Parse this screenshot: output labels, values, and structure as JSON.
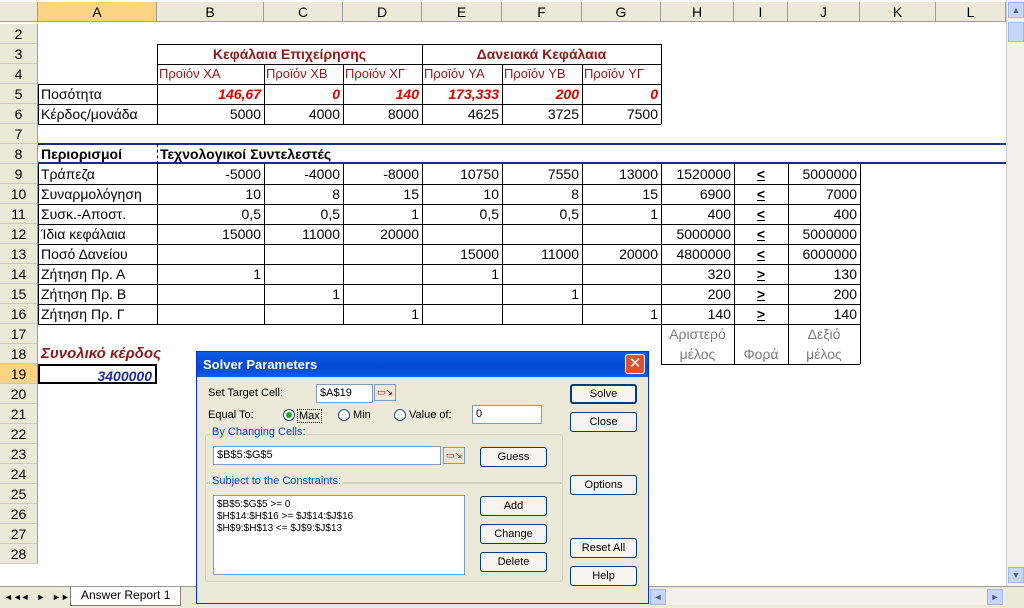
{
  "columns": [
    "A",
    "B",
    "C",
    "D",
    "E",
    "F",
    "G",
    "H",
    "I",
    "J",
    "K",
    "L"
  ],
  "selected_column": "A",
  "rows": [
    "2",
    "3",
    "4",
    "5",
    "6",
    "7",
    "8",
    "9",
    "10",
    "11",
    "12",
    "13",
    "14",
    "15",
    "16",
    "17",
    "18",
    "19",
    "20",
    "21",
    "22",
    "23",
    "24",
    "25",
    "26",
    "27",
    "28"
  ],
  "selected_row": "19",
  "sheet": {
    "header_capital": "Κεφάλαια Επιχείρησης",
    "header_loan": "Δανειακά Κεφάλαια",
    "products": [
      "Προϊόν XA",
      "Προϊόν XB",
      "Προϊόν XΓ",
      "Προϊόν YA",
      "Προϊόν YB",
      "Προϊόν YΓ"
    ],
    "row5_label": "Ποσότητα",
    "quantities": [
      "146,67",
      "0",
      "140",
      "173,333",
      "200",
      "0"
    ],
    "row6_label": "Κέρδος/μονάδα",
    "profits": [
      "5000",
      "4000",
      "8000",
      "4625",
      "3725",
      "7500"
    ],
    "constraints_title": "Περιορισμοί",
    "coeff_title": "Τεχνολογικοί  Συντελεστές",
    "constraint_rows": [
      {
        "label": "Τράπεζα",
        "b": "-5000",
        "c": "-4000",
        "d": "-8000",
        "e": "10750",
        "f": "7550",
        "g": "13000",
        "h": "1520000",
        "i": "<",
        "j": "5000000"
      },
      {
        "label": "Συναρμολόγηση",
        "b": "10",
        "c": "8",
        "d": "15",
        "e": "10",
        "f": "8",
        "g": "15",
        "h": "6900",
        "i": "<",
        "j": "7000"
      },
      {
        "label": "Συσκ.-Αποστ.",
        "b": "0,5",
        "c": "0,5",
        "d": "1",
        "e": "0,5",
        "f": "0,5",
        "g": "1",
        "h": "400",
        "i": "<",
        "j": "400"
      },
      {
        "label": "Ίδια κεφάλαια",
        "b": "15000",
        "c": "11000",
        "d": "20000",
        "e": "",
        "f": "",
        "g": "",
        "h": "5000000",
        "i": "<",
        "j": "5000000"
      },
      {
        "label": "Ποσό Δανείου",
        "b": "",
        "c": "",
        "d": "",
        "e": "15000",
        "f": "11000",
        "g": "20000",
        "h": "4800000",
        "i": "<",
        "j": "6000000"
      },
      {
        "label": "Ζήτηση Πρ.  Α",
        "b": "1",
        "c": "",
        "d": "",
        "e": "1",
        "f": "",
        "g": "",
        "h": "320",
        "i": ">",
        "j": "130"
      },
      {
        "label": "Ζήτηση Πρ.  Β",
        "b": "",
        "c": "1",
        "d": "",
        "e": "",
        "f": "1",
        "g": "",
        "h": "200",
        "i": ">",
        "j": "200"
      },
      {
        "label": "Ζήτηση Πρ.  Γ",
        "b": "",
        "c": "",
        "d": "1",
        "e": "",
        "f": "",
        "g": "1",
        "h": "140",
        "i": ">",
        "j": "140"
      }
    ],
    "lhs_label_1": "Αριστερό",
    "lhs_label_2": "μέλος",
    "direction_label": "Φορά",
    "rhs_label_1": "Δεξιό",
    "rhs_label_2": "μέλος",
    "total_profit_label": "Συνολικό κέρδος",
    "total_profit_value": "3400000"
  },
  "tabs": {
    "sheet_tab": "Answer Report 1",
    "nav": [
      "◄◄",
      "◄",
      "►",
      "►►"
    ]
  },
  "dialog": {
    "title": "Solver Parameters",
    "set_target_label": "Set Target Cell:",
    "target_cell": "$A$19",
    "equal_to_label": "Equal To:",
    "opt_max": "Max",
    "opt_min": "Min",
    "opt_value": "Value of:",
    "value_of": "0",
    "changing_label": "By Changing Cells:",
    "changing_cells": "$B$5:$G$5",
    "constraints_label": "Subject to the Constraints:",
    "constraints": [
      "$B$5:$G$5 >= 0",
      "$H$14:$H$16 >= $J$14:$J$16",
      "$H$9:$H$13 <= $J$9:$J$13"
    ],
    "btn_solve": "Solve",
    "btn_close": "Close",
    "btn_guess": "Guess",
    "btn_options": "Options",
    "btn_add": "Add",
    "btn_change": "Change",
    "btn_reset": "Reset All",
    "btn_delete": "Delete",
    "btn_help": "Help",
    "ref_icon": "collapse-ref-icon"
  },
  "colors": {
    "dark_red": "#8b1a1a",
    "bright_red": "#e00000",
    "blue_value": "#1f2d9c",
    "header": "#ece9d8",
    "selection": "#fdd384",
    "title_bar": "#0a5ce5"
  }
}
